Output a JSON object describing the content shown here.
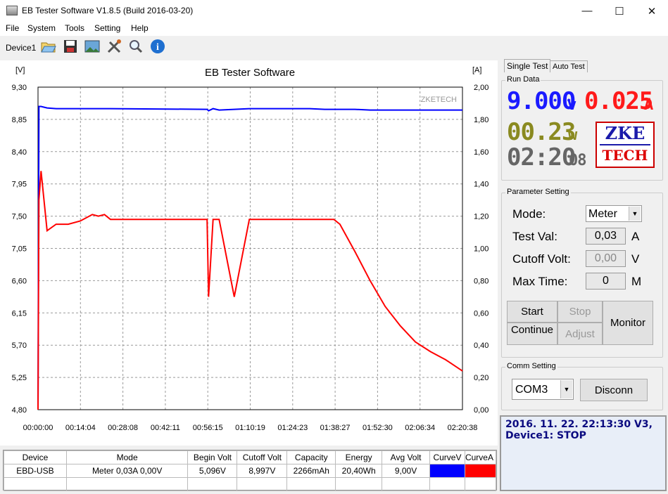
{
  "window": {
    "title": "EB Tester Software V1.8.5 (Build 2016-03-20)",
    "min": "—",
    "max": "☐",
    "close": "✕"
  },
  "menu": [
    "File",
    "System",
    "Tools",
    "Setting",
    "Help"
  ],
  "toolbar": {
    "device_label": "Device1",
    "icons": [
      "open-folder-icon",
      "save-icon",
      "image-icon",
      "tools-icon",
      "search-icon",
      "info-icon"
    ]
  },
  "chart": {
    "title": "EB Tester Software",
    "watermark": "ZKETECH",
    "left_unit": "[V]",
    "right_unit": "[A]",
    "left_ticks": [
      "9,30",
      "8,85",
      "8,40",
      "7,95",
      "7,50",
      "7,05",
      "6,60",
      "6,15",
      "5,70",
      "5,25",
      "4,80"
    ],
    "right_ticks": [
      "2,00",
      "1,80",
      "1,60",
      "1,40",
      "1,20",
      "1,00",
      "0,80",
      "0,60",
      "0,40",
      "0,20",
      "0,00"
    ],
    "x_ticks": [
      "00:00:00",
      "00:14:04",
      "00:28:08",
      "00:42:11",
      "00:56:15",
      "01:10:19",
      "01:24:23",
      "01:38:27",
      "01:52:30",
      "02:06:34",
      "02:20:38"
    ]
  },
  "chart_data": {
    "type": "line",
    "title": "EB Tester Software",
    "xlabel": "",
    "ylabel": "[V]",
    "y2label": "[A]",
    "ylim": [
      4.8,
      9.3
    ],
    "y2lim": [
      0.0,
      2.0
    ],
    "x_minutes": [
      0,
      0.3,
      1,
      3,
      6,
      10,
      14,
      18,
      20,
      22,
      24,
      56,
      56.5,
      58,
      60,
      65,
      70,
      75,
      80,
      85,
      90,
      95,
      98,
      100,
      105,
      110,
      115,
      120,
      125,
      130,
      135,
      140.6
    ],
    "series": [
      {
        "color": "#0000ff",
        "axis": "left",
        "values": [
          4.8,
          9.03,
          9.03,
          9.01,
          9.0,
          9.0,
          9.0,
          9.0,
          9.0,
          9.0,
          9.0,
          8.99,
          8.97,
          9.0,
          8.98,
          8.99,
          9.0,
          9.0,
          9.0,
          9.0,
          9.0,
          8.99,
          8.99,
          8.99,
          8.99,
          8.98,
          8.98,
          8.98,
          8.98,
          8.98,
          8.98,
          8.98
        ]
      },
      {
        "color": "#ff0000",
        "axis": "right",
        "values": [
          0.0,
          1.3,
          1.48,
          1.11,
          1.15,
          1.15,
          1.17,
          1.21,
          1.2,
          1.21,
          1.18,
          1.18,
          0.7,
          1.18,
          1.18,
          0.7,
          1.18,
          1.18,
          1.18,
          1.18,
          1.18,
          1.18,
          1.18,
          1.15,
          0.98,
          0.8,
          0.64,
          0.52,
          0.42,
          0.36,
          0.31,
          0.24
        ]
      }
    ]
  },
  "tabs": {
    "single": "Single Test",
    "auto": "Auto Test"
  },
  "run_data": {
    "title": "Run Data",
    "voltage": "9.000",
    "v_unit": "v",
    "current": "0.025",
    "a_unit": "A",
    "power": "00.23",
    "w_unit": "w",
    "time": "02:20",
    "time_sec": "08",
    "logo_top": "ZKE",
    "logo_bottom": "TECH"
  },
  "params": {
    "title": "Parameter Setting",
    "mode_label": "Mode:",
    "mode_value": "Meter",
    "test_label": "Test Val:",
    "test_value": "0,03",
    "test_unit": "A",
    "cutoff_label": "Cutoff Volt:",
    "cutoff_value": "0,00",
    "cutoff_unit": "V",
    "maxtime_label": "Max Time:",
    "maxtime_value": "0",
    "maxtime_unit": "M"
  },
  "buttons": {
    "start": "Start",
    "stop": "Stop",
    "continue": "Continue",
    "adjust": "Adjust",
    "monitor": "Monitor"
  },
  "comm": {
    "title": "Comm Setting",
    "port": "COM3",
    "disconnect": "Disconn"
  },
  "status": {
    "line1": "2016. 11. 22. 22:13:30  V3,",
    "line2": "Device1: STOP"
  },
  "table": {
    "headers": [
      "Device",
      "Mode",
      "Begin Volt",
      "Cutoff Volt",
      "Capacity",
      "Energy",
      "Avg Volt",
      "CurveV",
      "CurveA"
    ],
    "row": [
      "EBD-USB",
      "Meter  0,03A  0,00V",
      "5,096V",
      "8,997V",
      "2266mAh",
      "20,40Wh",
      "9,00V",
      "",
      ""
    ],
    "curve_colors": [
      "#0000ff",
      "#ff0000"
    ]
  }
}
